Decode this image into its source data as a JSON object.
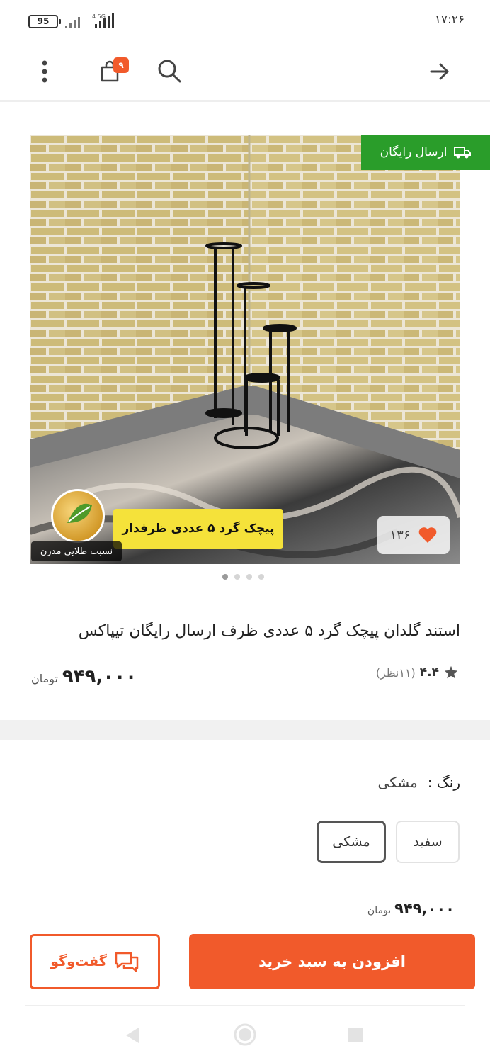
{
  "status_bar": {
    "time": "۱۷:۲۶",
    "battery": "95",
    "network": "4.5G"
  },
  "header": {
    "cart_count": "۹",
    "icons": [
      "more-vertical-icon",
      "cart-icon",
      "search-icon",
      "arrow-right-icon"
    ]
  },
  "gallery": {
    "free_shipping": "ارسال رایگان",
    "likes": "۱۳۶",
    "promo_text": "پیچک گرد ۵ عددی ظرفدار",
    "watermark": "نسبت طلایی مدرن",
    "total_slides": 4,
    "active_slide": 1
  },
  "product": {
    "title": "استند گلدان پیچک گرد ۵ عددی ظرف  ارسال رایگان تیپاکس",
    "rating": "۴.۴",
    "rating_count": "(۱۱نظر)",
    "price": "۹۴۹,۰۰۰",
    "currency": "تومان"
  },
  "color": {
    "label": "رنگ :",
    "selected": "مشکی",
    "options": [
      "سفید",
      "مشکی"
    ]
  },
  "footer": {
    "price": "۹۴۹,۰۰۰",
    "currency": "تومان",
    "add_to_cart": "افزودن به سبد خرید",
    "chat": "گفت‌وگو"
  },
  "colors": {
    "accent": "#f15a2b",
    "free_shipping_bg": "#2a9d2a",
    "heart": "#f15a2b"
  }
}
